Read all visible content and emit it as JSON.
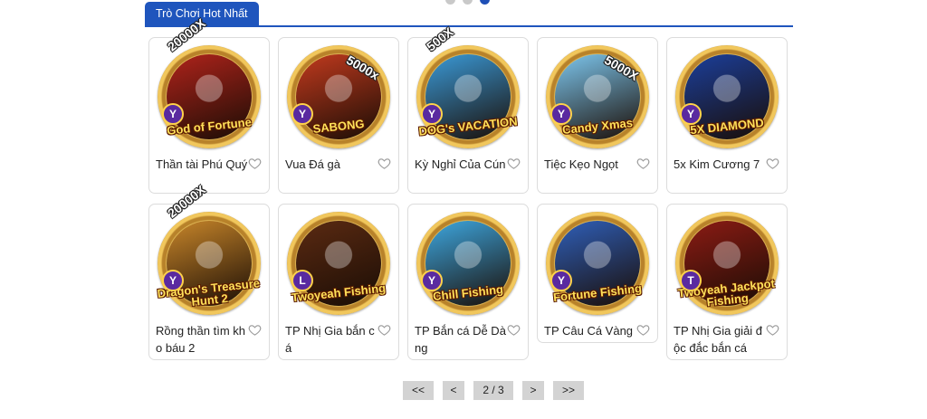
{
  "carousel": {
    "dots": 3,
    "active_dot": 3
  },
  "section": {
    "tab_label": "Trò Chơi Hot Nhất"
  },
  "colors": {
    "accent": "#1f55bd",
    "card_border": "#dcdcdc",
    "pager_bg": "#d3d3d3"
  },
  "games": [
    {
      "name": "Thần tài Phú Quý",
      "art_title": "God of Fortune",
      "multiplier": "20000X",
      "letter": "Y",
      "art_bg": "#b0231b",
      "short": false
    },
    {
      "name": "Vua Đá gà",
      "art_title": "SABONG",
      "multiplier": "5000x",
      "letter": "Y",
      "art_bg": "#c23a1e",
      "short": false
    },
    {
      "name": "Kỳ Nghỉ Của Cún",
      "art_title": "DOG's VACATION",
      "multiplier": "500X",
      "letter": "Y",
      "art_bg": "#3a9ad8",
      "short": false
    },
    {
      "name": "Tiệc Kẹo Ngọt",
      "art_title": "Candy Xmas",
      "multiplier": "5000X",
      "letter": "Y",
      "art_bg": "#7dc7ef",
      "short": false
    },
    {
      "name": "5x Kim Cương 7",
      "art_title": "5X DIAMOND",
      "multiplier": "",
      "letter": "Y",
      "art_bg": "#1b3f9c",
      "short": false
    },
    {
      "name": "Rồng thần tìm kho báu 2",
      "art_title": "Dragon's Treasure Hunt 2",
      "multiplier": "20000X",
      "letter": "Y",
      "art_bg": "#c8862a",
      "short": false
    },
    {
      "name": "TP Nhị Gia bắn cá",
      "art_title": "Twoyeah Fishing",
      "multiplier": "",
      "letter": "L",
      "art_bg": "#5b2a12",
      "short": false
    },
    {
      "name": "TP Bắn cá Dễ Dàng",
      "art_title": "Chill Fishing",
      "multiplier": "",
      "letter": "Y",
      "art_bg": "#3da7e0",
      "short": false
    },
    {
      "name": "TP Câu Cá Vàng",
      "art_title": "Fortune Fishing",
      "multiplier": "",
      "letter": "Y",
      "art_bg": "#2f5fb9",
      "short": true
    },
    {
      "name": "TP Nhị Gia giải độc đắc bắn cá",
      "art_title": "Twoyeah Jackpot Fishing",
      "multiplier": "",
      "letter": "T",
      "art_bg": "#8c1b14",
      "short": false
    }
  ],
  "pagination": {
    "first": "<<",
    "prev": "<",
    "current": "2 / 3",
    "next": ">",
    "last": ">>"
  }
}
